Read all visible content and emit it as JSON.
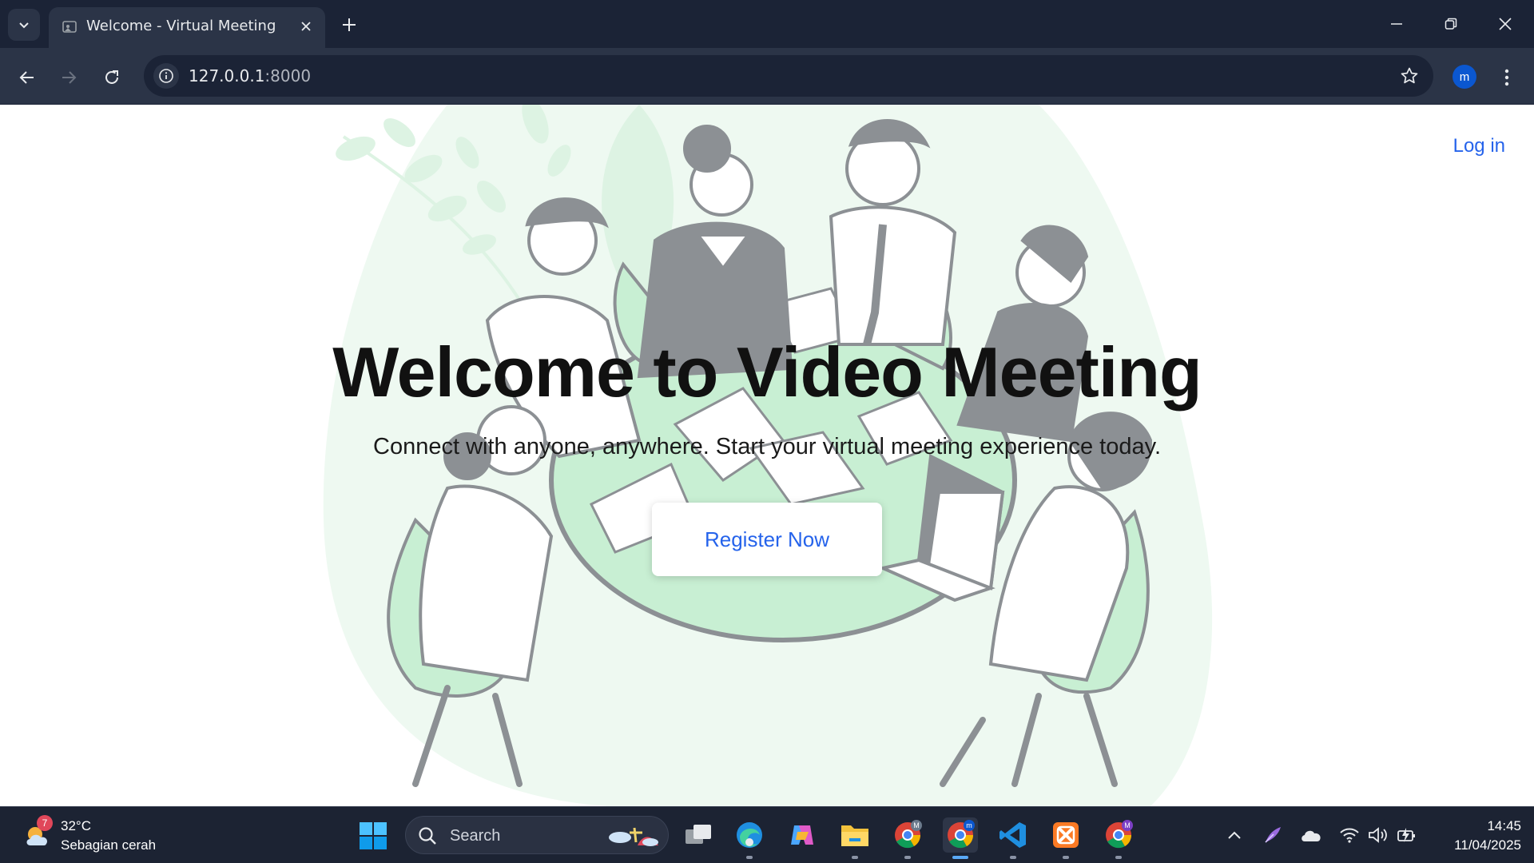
{
  "browser": {
    "tab": {
      "title": "Welcome - Virtual Meeting"
    },
    "address_bar": {
      "host": "127.0.0.1",
      "port": ":8000"
    },
    "profile": {
      "initial": "m"
    }
  },
  "page": {
    "nav": {
      "login_label": "Log in"
    },
    "hero": {
      "title": "Welcome to Video Meeting",
      "subtitle": "Connect with anyone, anywhere. Start your virtual meeting experience today.",
      "register_label": "Register Now"
    },
    "colors": {
      "accent": "#2563eb",
      "illustration_green": "#c8efd3",
      "illustration_gray": "#8c9094"
    }
  },
  "taskbar": {
    "weather": {
      "temperature": "32°C",
      "condition": "Sebagian cerah",
      "badge": "7"
    },
    "search": {
      "placeholder": "Search"
    },
    "apps": [
      "task-view",
      "edge",
      "copilot",
      "file-explorer",
      "chrome-profile-M",
      "chrome-profile-m",
      "vscode",
      "xampp",
      "chrome-profile-M-purple"
    ],
    "clock": {
      "time": "14:45",
      "date": "11/04/2025"
    }
  }
}
